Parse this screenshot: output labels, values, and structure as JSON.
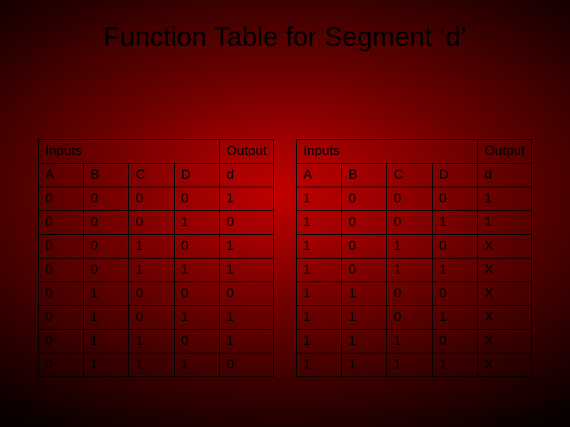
{
  "title": "Function Table for Segment ‘d’",
  "left": {
    "inputs_label": "Inputs",
    "output_label": "Output",
    "cols": [
      "A",
      "B",
      "C",
      "D",
      "d"
    ],
    "rows": [
      [
        "0",
        "0",
        "0",
        "0",
        "1"
      ],
      [
        "0",
        "0",
        "0",
        "1",
        "0"
      ],
      [
        "0",
        "0",
        "1",
        "0",
        "1"
      ],
      [
        "0",
        "0",
        "1",
        "1",
        "1"
      ],
      [
        "0",
        "1",
        "0",
        "0",
        "0"
      ],
      [
        "0",
        "1",
        "0",
        "1",
        "1"
      ],
      [
        "0",
        "1",
        "1",
        "0",
        "1"
      ],
      [
        "0",
        "1",
        "1",
        "1",
        "0"
      ]
    ]
  },
  "right": {
    "inputs_label": "Inputs",
    "output_label": "Output",
    "cols": [
      "A",
      "B",
      "C",
      "D",
      "d"
    ],
    "rows": [
      [
        "1",
        "0",
        "0",
        "0",
        "1"
      ],
      [
        "1",
        "0",
        "0",
        "1",
        "1"
      ],
      [
        "1",
        "0",
        "1",
        "0",
        "X"
      ],
      [
        "1",
        "0",
        "1",
        "1",
        "X"
      ],
      [
        "1",
        "1",
        "0",
        "0",
        "X"
      ],
      [
        "1",
        "1",
        "0",
        "1",
        "X"
      ],
      [
        "1",
        "1",
        "1",
        "0",
        "X"
      ],
      [
        "1",
        "1",
        "1",
        "1",
        "X"
      ]
    ]
  },
  "chart_data": {
    "type": "table",
    "title": "Function Table for Segment 'd'",
    "columns": [
      "A",
      "B",
      "C",
      "D",
      "d"
    ],
    "rows": [
      [
        "0",
        "0",
        "0",
        "0",
        "1"
      ],
      [
        "0",
        "0",
        "0",
        "1",
        "0"
      ],
      [
        "0",
        "0",
        "1",
        "0",
        "1"
      ],
      [
        "0",
        "0",
        "1",
        "1",
        "1"
      ],
      [
        "0",
        "1",
        "0",
        "0",
        "0"
      ],
      [
        "0",
        "1",
        "0",
        "1",
        "1"
      ],
      [
        "0",
        "1",
        "1",
        "0",
        "1"
      ],
      [
        "0",
        "1",
        "1",
        "1",
        "0"
      ],
      [
        "1",
        "0",
        "0",
        "0",
        "1"
      ],
      [
        "1",
        "0",
        "0",
        "1",
        "1"
      ],
      [
        "1",
        "0",
        "1",
        "0",
        "X"
      ],
      [
        "1",
        "0",
        "1",
        "1",
        "X"
      ],
      [
        "1",
        "1",
        "0",
        "0",
        "X"
      ],
      [
        "1",
        "1",
        "0",
        "1",
        "X"
      ],
      [
        "1",
        "1",
        "1",
        "0",
        "X"
      ],
      [
        "1",
        "1",
        "1",
        "1",
        "X"
      ]
    ]
  }
}
